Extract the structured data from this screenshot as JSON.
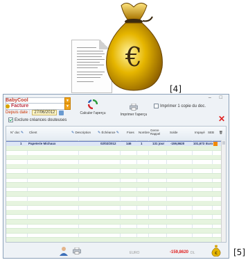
{
  "illustration": {
    "moneybag_icon": "moneybag-euro-icon",
    "document_icon": "document-icon",
    "callout_4": "[4]",
    "callout_5": "[5]"
  },
  "window": {
    "controls": "– □",
    "company": "BabyCool",
    "doc_type": "Facture",
    "date_label": "Depuis date :",
    "date_value": "27/06/2012",
    "exclude_label": "Exclure créances douteuses",
    "exclude_checked": true,
    "calc_label": "Calculer l'aperçu",
    "print_label": "Imprimer l'aperçu",
    "print_copy_label": "Imprimer 1 copie du doc.",
    "close_symbol": "✕"
  },
  "table": {
    "columns": [
      "N° doc",
      "Client",
      "Description",
      "Échéance",
      "Fixes",
      "Nombre",
      "Genre Rappel",
      "Solde",
      "Impayé",
      "SEB"
    ],
    "rows": [
      [
        "1",
        "Papeterie Michaux",
        "",
        "02/02/2012",
        "146",
        "1",
        "131 jour",
        "-159,8620",
        "101,673",
        "Euro"
      ]
    ],
    "empty_rows": 21
  },
  "footer": {
    "euro_label": "EURO",
    "total": "-159,8620",
    "dl_label": "DL"
  }
}
